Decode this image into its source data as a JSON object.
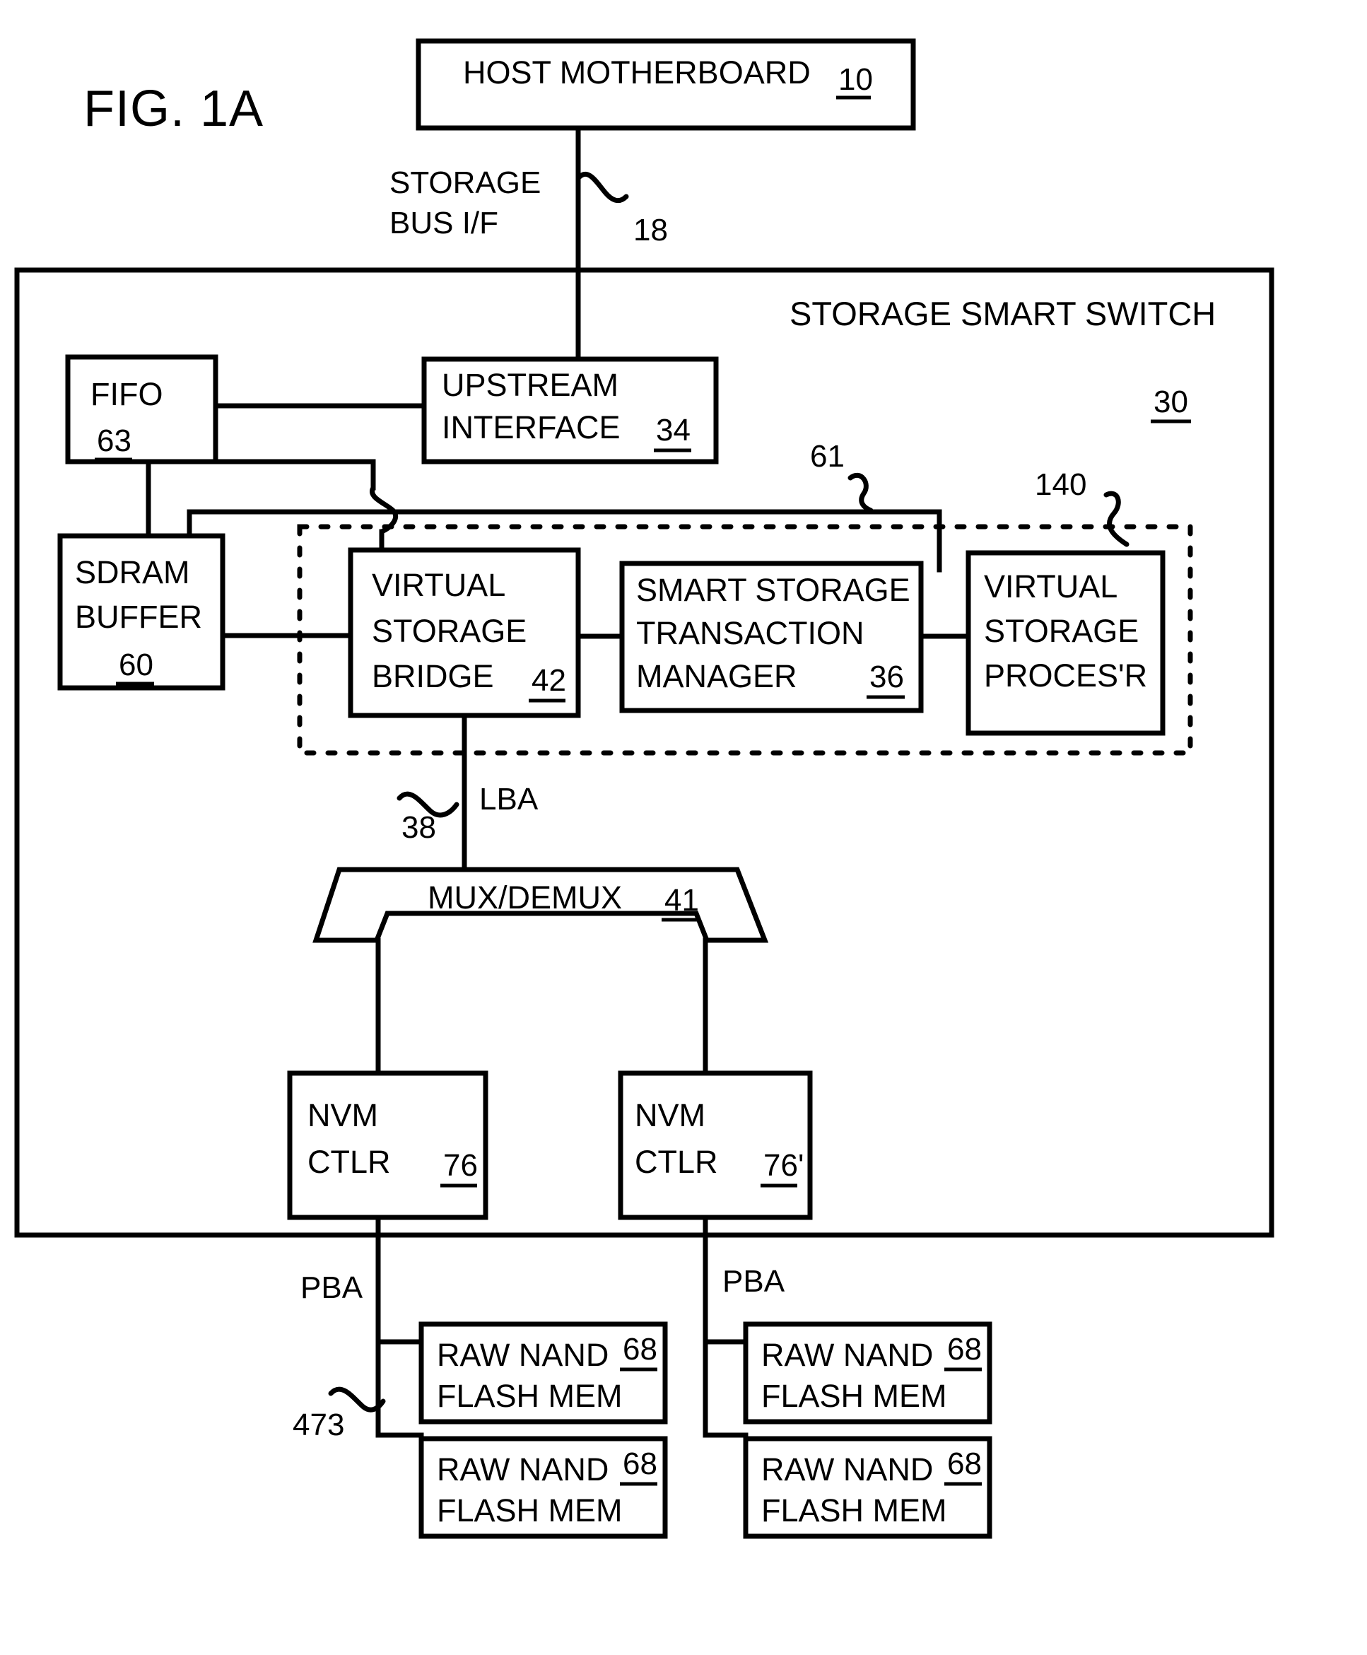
{
  "figure": {
    "label": "FIG. 1A"
  },
  "blocks": {
    "host_motherboard": {
      "title": "HOST MOTHERBOARD",
      "ref": "10"
    },
    "fifo": {
      "title": "FIFO",
      "ref": "63"
    },
    "sdram_buffer": {
      "line1": "SDRAM",
      "line2": "BUFFER",
      "ref": "60"
    },
    "upstream_interface": {
      "line1": "UPSTREAM",
      "line2": "INTERFACE",
      "ref": "34"
    },
    "virtual_storage_bridge": {
      "line1": "VIRTUAL",
      "line2": "STORAGE",
      "line3": "BRIDGE",
      "ref": "42"
    },
    "smart_storage_transaction_manager": {
      "line1": "SMART STORAGE",
      "line2": "TRANSACTION",
      "line3": "MANAGER",
      "ref": "36"
    },
    "virtual_storage_processor": {
      "line1": "VIRTUAL",
      "line2": "STORAGE",
      "line3": "PROCES'R",
      "ref": "140"
    },
    "mux_demux": {
      "title": "MUX/DEMUX",
      "ref": "41"
    },
    "nvm_ctlr_left": {
      "line1": "NVM",
      "line2": "CTLR",
      "ref": "76"
    },
    "nvm_ctlr_right": {
      "line1": "NVM",
      "line2": "CTLR",
      "ref": "76'"
    },
    "flash_left_top": {
      "line1": "RAW NAND",
      "line2": "FLASH MEM",
      "ref": "68"
    },
    "flash_left_bottom": {
      "line1": "RAW NAND",
      "line2": "FLASH MEM",
      "ref": "68"
    },
    "flash_right_top": {
      "line1": "RAW NAND",
      "line2": "FLASH MEM",
      "ref": "68"
    },
    "flash_right_bottom": {
      "line1": "RAW NAND",
      "line2": "FLASH MEM",
      "ref": "68"
    }
  },
  "enclosure": {
    "title": "STORAGE SMART SWITCH",
    "ref": "30"
  },
  "labels": {
    "storage_bus_if_line1": "STORAGE",
    "storage_bus_if_line2": "BUS I/F",
    "storage_bus_ref": "18",
    "lba": "LBA",
    "lba_ref": "38",
    "bus_61_ref": "61",
    "processor_ref": "140",
    "pba_left": "PBA",
    "pba_right": "PBA",
    "pba_ref": "473"
  },
  "colors": {
    "ink": "#000000",
    "paper": "#ffffff"
  }
}
